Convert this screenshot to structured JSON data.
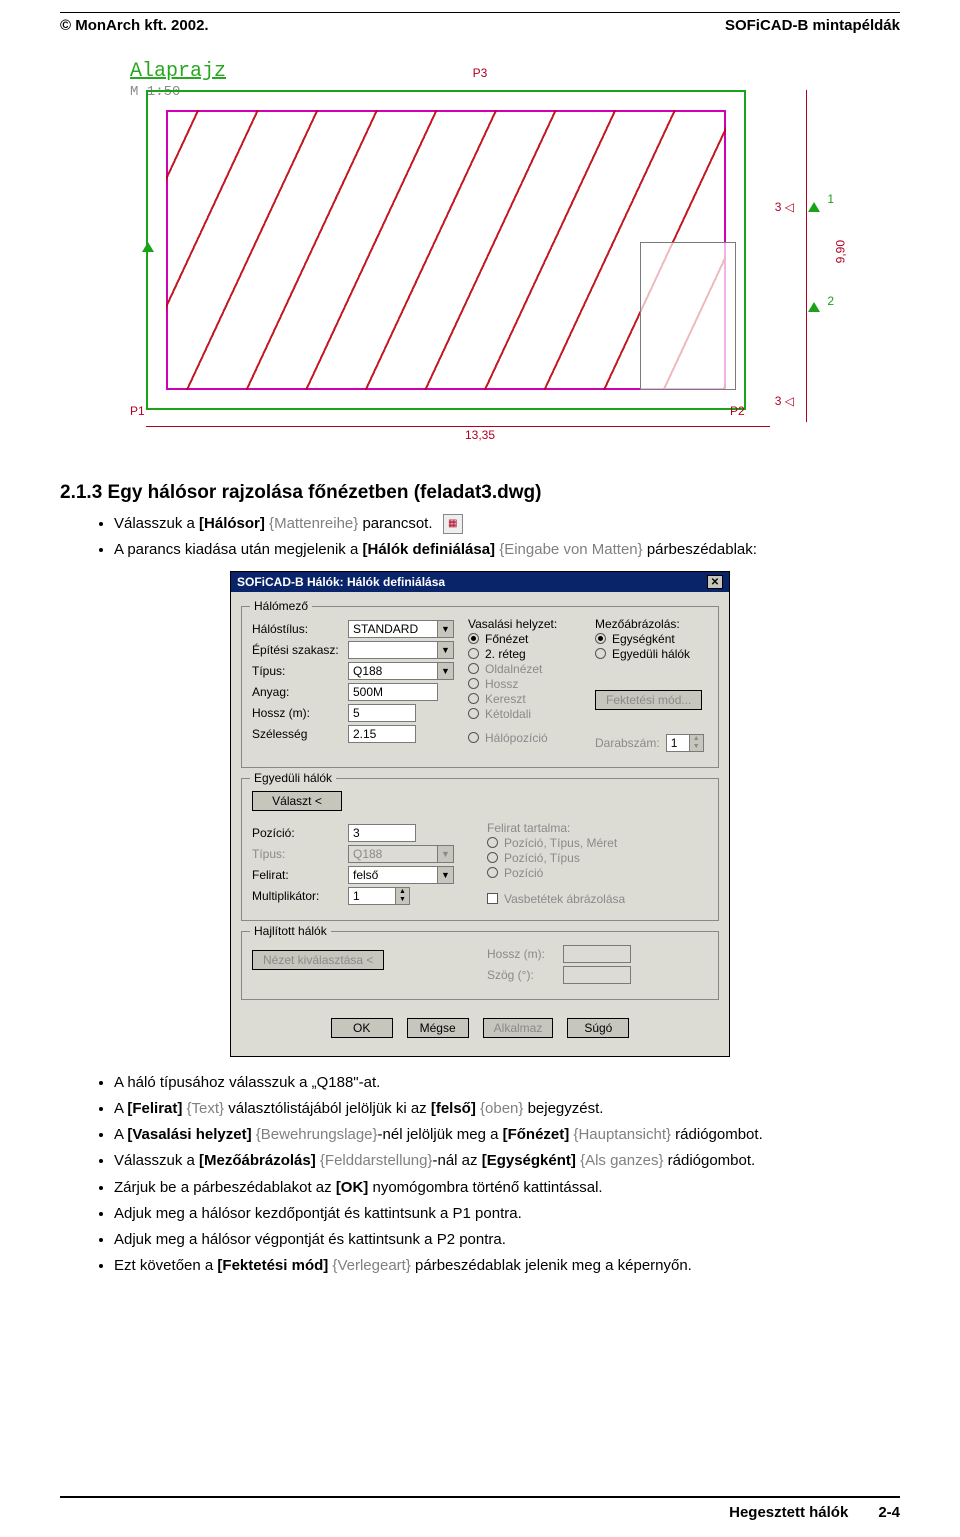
{
  "header": {
    "left": "© MonArch kft. 2002.",
    "right": "SOFiCAD-B mintapéldák"
  },
  "drawing": {
    "title": "Alaprajz",
    "scale": "M 1:50",
    "p1": "P1",
    "p2": "P2",
    "p3": "P3",
    "dim_bottom": "13,35",
    "dim_right": "9,90",
    "side_3_top": "3 ◁",
    "side_3_bottom": "3 ◁",
    "side_1": "1",
    "side_2": "2"
  },
  "section_title": "2.1.3 Egy hálósor rajzolása főnézetben (feladat3.dwg)",
  "bullets_top": {
    "b1_pre": "Válasszuk a ",
    "b1_bold": "[Hálósor]",
    "b1_gray": " {Mattenreihe}",
    "b1_post": " parancsot.",
    "b2_pre": "A parancs kiadása után megjelenik a ",
    "b2_bold": "[Hálók definiálása]",
    "b2_gray": " {Eingabe von Matten}",
    "b2_post": " párbeszédablak:"
  },
  "dialog": {
    "title": "SOFiCAD-B Hálók: Hálók definiálása",
    "group_halomezo": "Hálómező",
    "labels": {
      "halostilus": "Hálóstílus:",
      "epitesi": "Építési szakasz:",
      "tipus": "Típus:",
      "anyag": "Anyag:",
      "hossz": "Hossz (m):",
      "szelesseg": "Szélesség",
      "vasalasi": "Vasalási helyzet:",
      "mezoabr": "Mezőábrázolás:",
      "darabszam": "Darabszám:"
    },
    "values": {
      "halostilus": "STANDARD",
      "epitesi": "",
      "tipus": "Q188",
      "anyag": "500M",
      "hossz": "5",
      "szelesseg": "2.15",
      "darabszam": "1"
    },
    "vasalasi_opts": {
      "fonezet": "Főnézet",
      "reteg2": "2. réteg",
      "oldalnezet": "Oldalnézet",
      "hossz": "Hossz",
      "kereszt": "Kereszt",
      "ketoldali": "Kétoldali",
      "halopoz": "Hálópozíció"
    },
    "mezoabr_opts": {
      "egysegkent": "Egységként",
      "egyeduli": "Egyedüli hálók"
    },
    "btn_fektetesi": "Fektetési mód...",
    "group_egyeduli": "Egyedüli hálók",
    "btn_valaszt": "Választ <",
    "eh_labels": {
      "pozicio": "Pozíció:",
      "tipus": "Típus:",
      "felirat": "Felirat:",
      "multiplikator": "Multiplikátor:",
      "felirat_tartalma": "Felirat tartalma:"
    },
    "eh_values": {
      "pozicio": "3",
      "tipus": "Q188",
      "felirat": "felső",
      "multiplikator": "1"
    },
    "felirat_opts": {
      "p_t_m": "Pozíció, Típus, Méret",
      "p_t": "Pozíció, Típus",
      "p": "Pozíció"
    },
    "chk_vasbetertek": "Vasbetétek ábrázolása",
    "group_hajlitott": "Hajlított hálók",
    "btn_nezet": "Nézet kiválasztása <",
    "haj_labels": {
      "hossz": "Hossz (m):",
      "szog": "Szög (°):"
    },
    "buttons": {
      "ok": "OK",
      "megse": "Mégse",
      "alkalmaz": "Alkalmaz",
      "sugo": "Súgó"
    }
  },
  "bullets_bottom": {
    "i1": {
      "pre": "A háló típusához válasszuk a „Q188\"-at."
    },
    "i2": {
      "pre": "A ",
      "b1": "[Felirat]",
      "g1": " {Text}",
      "mid": " választólistájából jelöljük ki az ",
      "b2": "[felső]",
      "g2": " {oben}",
      "post": " bejegyzést."
    },
    "i3": {
      "pre": "A ",
      "b1": "[Vasalási helyzet]",
      "g1": " {Bewehrungslage}",
      "mid": "-nél jelöljük meg a ",
      "b2": "[Főnézet]",
      "g2": " {Hauptansicht}",
      "post": " rádiógombot."
    },
    "i4": {
      "pre": "Válasszuk a ",
      "b1": "[Mezőábrázolás]",
      "g1": " {Felddarstellung}",
      "mid": "-nál az ",
      "b2": "[Egységként]",
      "g2": " {Als ganzes}",
      "post": " rádiógombot."
    },
    "i5": {
      "pre": "Zárjuk be a párbeszédablakot az ",
      "b1": "[OK]",
      "post": " nyomógombra történő kattintással."
    },
    "i6": {
      "pre": "Adjuk meg a hálósor kezdőpontját és kattintsunk a P1 pontra."
    },
    "i7": {
      "pre": "Adjuk meg a hálósor végpontját és kattintsunk a P2 pontra."
    },
    "i8": {
      "pre": "Ezt követően a ",
      "b1": "[Fektetési mód]",
      "g1": " {Verlegeart}",
      "post": " párbeszédablak jelenik meg a képernyőn."
    }
  },
  "footer": {
    "title": "Hegesztett hálók",
    "page": "2-4"
  }
}
